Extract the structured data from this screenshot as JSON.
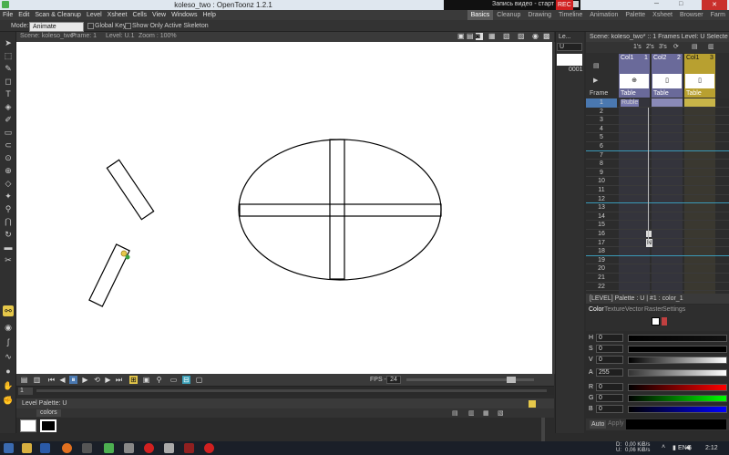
{
  "window": {
    "title": "koleso_two : OpenToonz 1.2.1"
  },
  "recorder": {
    "label": "Запись видео - старт",
    "rec": "REC"
  },
  "menu": [
    "File",
    "Edit",
    "Scan & Cleanup",
    "Level",
    "Xsheet",
    "Cells",
    "View",
    "Windows",
    "Help"
  ],
  "rooms": [
    "Basics",
    "Cleanup",
    "Drawing",
    "Timeline",
    "Animation",
    "Palette",
    "Xsheet",
    "Browser",
    "Farm"
  ],
  "modebar": {
    "mode_label": "Mode:",
    "mode_value": "Animate",
    "global_key": "Global Key",
    "active_skel": "Show Only Active Skeleton"
  },
  "viewer": {
    "scene": "Scene: koleso_two*",
    "frame": "Frame: 1",
    "level": "Level: U.1",
    "zoom": "Zoom : 100%"
  },
  "playback": {
    "fps_label": "FPS --",
    "fps_value": "24",
    "frame_field": "1"
  },
  "palette": {
    "title": "Level Palette: U",
    "tab": "colors"
  },
  "levelstrip": {
    "title": "Le...",
    "level": "U",
    "frame_label": "0001"
  },
  "xsheet": {
    "header": "Scene: koleso_two*  ::  1 Frames  Level: U  Selecte...",
    "controls": [
      "1's",
      "2's",
      "3's"
    ],
    "columns": [
      {
        "name": "Col1",
        "num": "1",
        "label": "Table"
      },
      {
        "name": "Col2",
        "num": "2",
        "label": "Table"
      },
      {
        "name": "Col1",
        "num": "3",
        "label": "Table"
      }
    ],
    "frame_label": "Frame",
    "rows": [
      "1",
      "2",
      "3",
      "4",
      "5",
      "6",
      "7",
      "8",
      "9",
      "10",
      "11",
      "12",
      "13",
      "14",
      "15",
      "16",
      "17",
      "18",
      "19",
      "20",
      "21",
      "22"
    ],
    "cell_first": "Ruble",
    "marker": "N"
  },
  "style": {
    "header": "[LEVEL]  Palette : U | #1 : color_1",
    "tabs": [
      "Color",
      "Texture",
      "Vector",
      "Raster",
      "Settings"
    ],
    "channels": [
      {
        "k": "H",
        "v": "0"
      },
      {
        "k": "S",
        "v": "0"
      },
      {
        "k": "V",
        "v": "0"
      },
      {
        "k": "A",
        "v": "255"
      },
      {
        "k": "R",
        "v": "0"
      },
      {
        "k": "G",
        "v": "0"
      },
      {
        "k": "B",
        "v": "0"
      }
    ],
    "auto": "Auto",
    "apply": "Apply"
  },
  "taskbar": {
    "lang": "ENG",
    "time": "2:12",
    "net_d": "0,00 KiB/s",
    "net_u": "0,06 KiB/s",
    "net_d_label": "D:",
    "net_u_label": "U:"
  },
  "colors": {
    "accent": "#e6c84a",
    "rec": "#d02020"
  }
}
